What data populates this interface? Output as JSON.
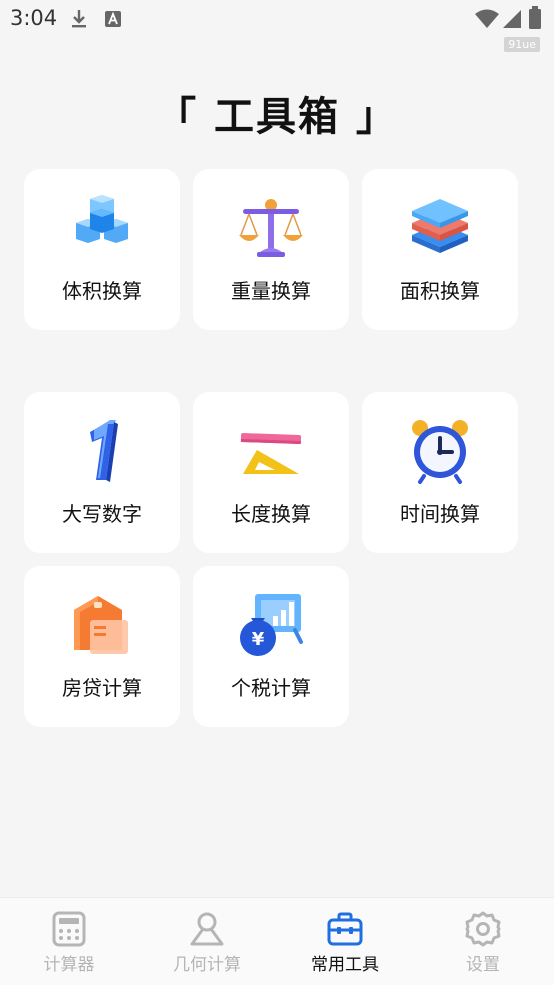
{
  "status_bar": {
    "time": "3:04",
    "watermark": "91ue"
  },
  "page": {
    "title": "「 工具箱 」"
  },
  "tools": [
    {
      "label": "体积换算",
      "icon": "cubes-icon"
    },
    {
      "label": "重量换算",
      "icon": "scale-icon"
    },
    {
      "label": "面积换算",
      "icon": "layers-icon"
    },
    {
      "label": "大写数字",
      "icon": "number-one-icon"
    },
    {
      "label": "长度换算",
      "icon": "ruler-triangle-icon"
    },
    {
      "label": "时间换算",
      "icon": "alarm-clock-icon"
    },
    {
      "label": "房贷计算",
      "icon": "house-icon"
    },
    {
      "label": "个税计算",
      "icon": "money-bag-chart-icon"
    }
  ],
  "tabs": [
    {
      "label": "计算器",
      "icon": "calculator-icon",
      "active": false
    },
    {
      "label": "几何计算",
      "icon": "geometry-icon",
      "active": false
    },
    {
      "label": "常用工具",
      "icon": "toolbox-icon",
      "active": true
    },
    {
      "label": "设置",
      "icon": "gear-icon",
      "active": false
    }
  ],
  "colors": {
    "accent": "#1f6fe0",
    "tab_inactive": "#b5b5b5",
    "background": "#f5f5f5"
  }
}
